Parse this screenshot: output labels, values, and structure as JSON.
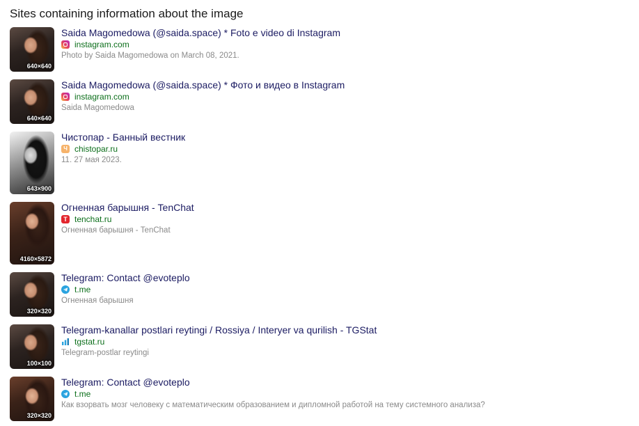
{
  "heading": "Sites containing information about the image",
  "results": [
    {
      "title": "Saida Magomedowa (@saida.space) * Foto e video di Instagram",
      "site": "instagram.com",
      "favicon": "instagram-icon",
      "snippet": "Photo by Saida Magomedowa on March 08, 2021.",
      "resolution": "640×640"
    },
    {
      "title": "Saida Magomedowa (@saida.space) * Фото и видео в Instagram",
      "site": "instagram.com",
      "favicon": "instagram-icon",
      "snippet": "Saida Magomedowa",
      "resolution": "640×640"
    },
    {
      "title": "Чистопар - Банный вестник",
      "site": "chistopar.ru",
      "favicon": "chistopar-icon",
      "snippet": "11. 27 мая 2023.",
      "resolution": "643×900"
    },
    {
      "title": "Огненная барышня - TenChat",
      "site": "tenchat.ru",
      "favicon": "tenchat-icon",
      "snippet": "Огненная барышня - TenChat",
      "resolution": "4160×5872"
    },
    {
      "title": "Telegram: Contact @evoteplo",
      "site": "t.me",
      "favicon": "telegram-icon",
      "snippet": "Огненная барышня",
      "resolution": "320×320"
    },
    {
      "title": "Telegram-kanallar postlari reytingi / Rossiya / Interyer va qurilish - TGStat",
      "site": "tgstat.ru",
      "favicon": "tgstat-icon",
      "snippet": "Telegram-postlar reytingi",
      "resolution": "100×100"
    },
    {
      "title": "Telegram: Contact @evoteplo",
      "site": "t.me",
      "favicon": "telegram-icon",
      "snippet": "Как взорвать мозг человеку с математическим образованием и дипломной работой на тему системного анализа?",
      "resolution": "320×320"
    }
  ]
}
